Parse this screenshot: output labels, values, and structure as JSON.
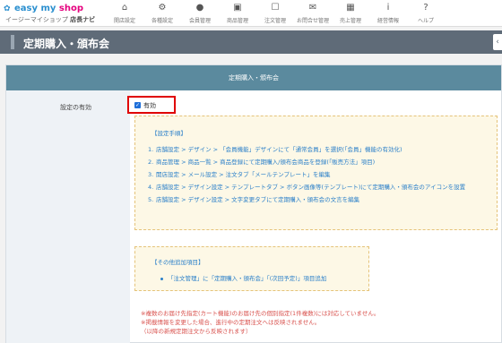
{
  "header": {
    "logo_mark": "✿",
    "logo_easy": "easy",
    "logo_my": " my ",
    "logo_shop": "shop",
    "logo_sub_prefix": "イージーマイショップ",
    "logo_sub_suffix": "店長ナビ",
    "nav": [
      {
        "label": "開店設定",
        "icon": "home-icon"
      },
      {
        "label": "各種設定",
        "icon": "gear-icon"
      },
      {
        "label": "会員管理",
        "icon": "user-icon"
      },
      {
        "label": "商品管理",
        "icon": "box-icon"
      },
      {
        "label": "注文管理",
        "icon": "order-icon"
      },
      {
        "label": "お問合せ管理",
        "icon": "mail-icon"
      },
      {
        "label": "売上管理",
        "icon": "calculator-icon"
      },
      {
        "label": "経営情報",
        "icon": "info-icon"
      },
      {
        "label": "ヘルプ",
        "icon": "help-icon"
      }
    ]
  },
  "page": {
    "title": "定期購入・頒布会",
    "panel_heading": "定期購入・頒布会",
    "field_label": "設定の有効",
    "checkbox_label": "有効",
    "checkbox_checked": true,
    "highlight_color": "#e00000"
  },
  "guide": {
    "title": "【設定手順】",
    "steps": [
      {
        "num": "1.",
        "text": "店舗設定 > デザイン > 「会員機能」デザインにて「通常会員」を選択(「会員」機能の有効化)"
      },
      {
        "num": "2.",
        "text": "商品管理 > 商品一覧 > 商品登録にて定期購入/頒布会商品を登録(「販売方法」項目)"
      },
      {
        "num": "3.",
        "text": "開店設定 > メール設定 > 注文タブ「メールテンプレート」を編集"
      },
      {
        "num": "4.",
        "text": "店舗設定 > デザイン設定 > テンプレートタブ > ボタン画像等(テンプレート)にて定期購入・頒布会のアイコンを設置"
      },
      {
        "num": "5.",
        "text": "店舗設定 > デザイン設定 > 文字変更タブにて定期購入・頒布会の文言を編集"
      }
    ]
  },
  "extra": {
    "title": "【その他追加項目】",
    "items": [
      "「注文管理」に「定期購入・頒布会」「(次回予定)」項目追加"
    ]
  },
  "notes": [
    "※複数のお届け先指定(カート機能)のお届け先の個別指定(1件複数)には対応していません。",
    "※掲載情報を変更した場合、進行中の定期注文へは反映されません。",
    "（以降の新規定期注文から反映されます）"
  ]
}
